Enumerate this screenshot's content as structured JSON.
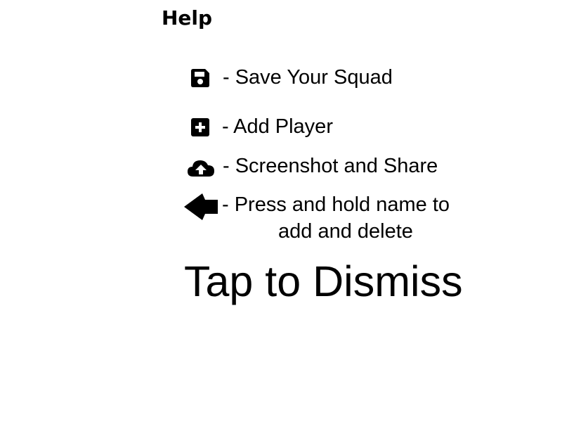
{
  "app": {
    "title": "Help"
  },
  "help_items": [
    {
      "icon": "save-icon",
      "text": "- Save Your Squad"
    },
    {
      "icon": "add-square-icon",
      "text": "- Add Player"
    },
    {
      "icon": "cloud-upload-icon",
      "text": "- Screenshot and Share"
    },
    {
      "icon": "arrow-left-icon",
      "text": "- Press and hold name to",
      "text2": "add and delete"
    }
  ],
  "dismiss_label": "Tap to Dismiss"
}
